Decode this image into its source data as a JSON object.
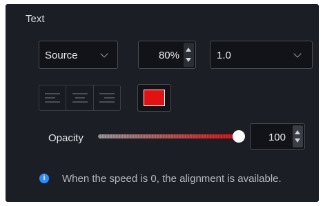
{
  "text_section": {
    "title": "Text",
    "source_select": {
      "value": "Source"
    },
    "percent_input": {
      "value": "80%"
    },
    "scale_select": {
      "value": "1.0"
    },
    "alignment_buttons": [
      "align-left",
      "align-center",
      "align-right"
    ],
    "text_color": "#e01212",
    "opacity": {
      "label": "Opacity",
      "value": "100",
      "slider_fraction": 1.0
    },
    "info": {
      "icon": "info-icon",
      "text": "When the speed is 0, the alignment is available."
    }
  }
}
